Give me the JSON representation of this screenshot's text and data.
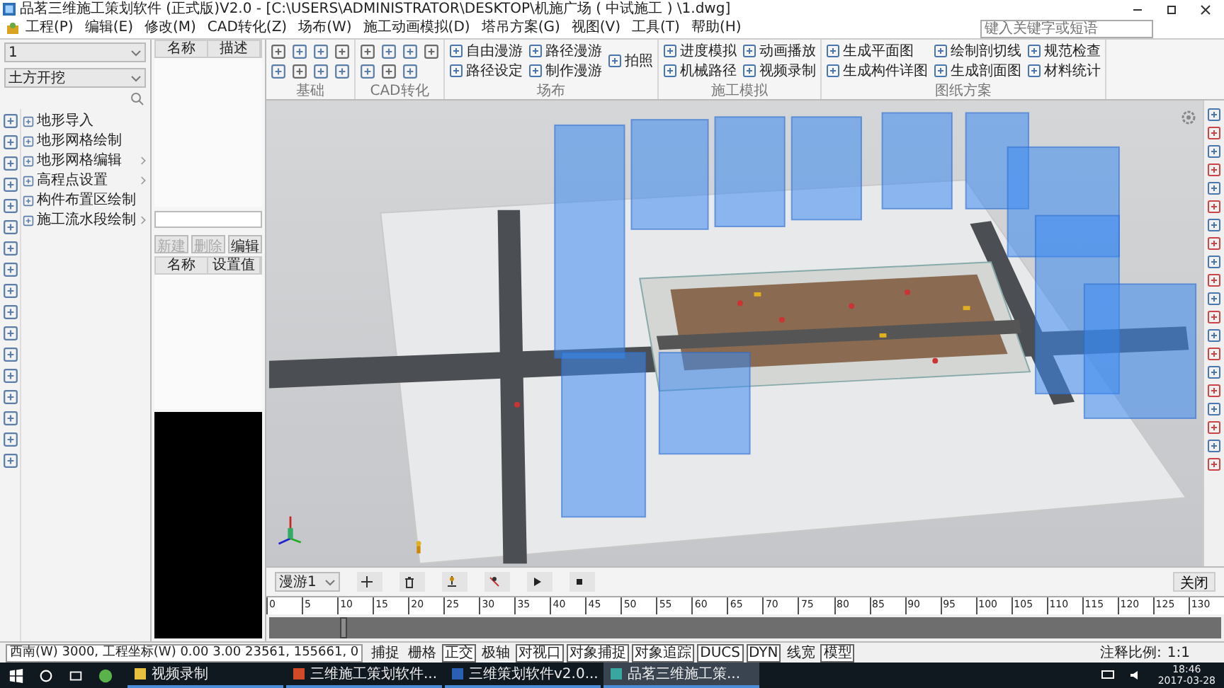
{
  "window": {
    "title": "品茗三维施工策划软件 (正式版)V2.0 - [C:\\USERS\\ADMINISTRATOR\\DESKTOP\\机施广场 ( 中试施工 ) \\1.dwg]"
  },
  "menu": [
    "工程(P)",
    "编辑(E)",
    "修改(M)",
    "CAD转化(Z)",
    "场布(W)",
    "施工动画模拟(D)",
    "塔吊方案(G)",
    "视图(V)",
    "工具(T)",
    "帮助(H)"
  ],
  "search": {
    "placeholder": "键入关键字或短语"
  },
  "ribbon": {
    "groups": [
      {
        "label": "基础",
        "kind": "icons"
      },
      {
        "label": "CAD转化",
        "kind": "icons"
      },
      {
        "label": "场布",
        "kind": "tools",
        "tools": [
          {
            "label": "自由漫游",
            "kind": "small"
          },
          {
            "label": "路径设定",
            "kind": "small"
          },
          {
            "label": "路径漫游",
            "kind": "small"
          },
          {
            "label": "制作漫游",
            "kind": "small"
          },
          {
            "label": "拍照",
            "kind": "large"
          }
        ]
      },
      {
        "label": "施工模拟",
        "kind": "tools",
        "tools": [
          {
            "label": "进度模拟",
            "kind": "small"
          },
          {
            "label": "机械路径",
            "kind": "small"
          },
          {
            "label": "动画播放",
            "kind": "small"
          },
          {
            "label": "视频录制",
            "kind": "small"
          }
        ]
      },
      {
        "label": "图纸方案",
        "kind": "tools",
        "tools": [
          {
            "label": "生成平面图",
            "kind": "small"
          },
          {
            "label": "生成构件详图",
            "kind": "small"
          },
          {
            "label": "绘制剖切线",
            "kind": "small"
          },
          {
            "label": "生成剖面图",
            "kind": "small"
          },
          {
            "label": "规范检查",
            "kind": "small"
          },
          {
            "label": "材料统计",
            "kind": "small"
          }
        ]
      }
    ]
  },
  "left_panel": {
    "layer": "1",
    "stage": "土方开挖",
    "items": [
      {
        "label": "地形导入",
        "has_submenu": false
      },
      {
        "label": "地形网格绘制",
        "has_submenu": false
      },
      {
        "label": "地形网格编辑",
        "has_submenu": true
      },
      {
        "label": "高程点设置",
        "has_submenu": true
      },
      {
        "label": "构件布置区绘制",
        "has_submenu": false
      },
      {
        "label": "施工流水段绘制",
        "has_submenu": true
      }
    ]
  },
  "props_panel": {
    "columns": [
      "名称",
      "描述"
    ],
    "buttons": [
      {
        "label": "新建",
        "disabled": true
      },
      {
        "label": "删除",
        "disabled": true
      },
      {
        "label": "编辑",
        "disabled": false
      }
    ],
    "settings_columns": [
      "名称",
      "设置值"
    ]
  },
  "animation": {
    "track": "漫游1",
    "close": "关闭",
    "ticks": [
      "0",
      "5",
      "10",
      "15",
      "20",
      "25",
      "30",
      "35",
      "40",
      "45",
      "50",
      "55",
      "60",
      "65",
      "70",
      "75",
      "80",
      "85",
      "90",
      "95",
      "100",
      "105",
      "110",
      "115",
      "120",
      "125",
      "130"
    ],
    "playhead": {
      "level": 0.075
    }
  },
  "status_bar": {
    "coords": "西南(W) 3000, 工程坐标(W) 0.00 3.00  23561,  155661,  0",
    "toggles": [
      {
        "label": "捕捉",
        "on": false
      },
      {
        "label": "栅格",
        "on": false
      },
      {
        "label": "正交",
        "on": true
      },
      {
        "label": "极轴",
        "on": false
      },
      {
        "label": "对视口",
        "on": true
      },
      {
        "label": "对象捕捉",
        "on": true
      },
      {
        "label": "对象追踪",
        "on": true
      },
      {
        "label": "DUCS",
        "on": true
      },
      {
        "label": "DYN",
        "on": true
      },
      {
        "label": "线宽",
        "on": false
      },
      {
        "label": "模型",
        "on": true
      }
    ],
    "scale_label": "注释比例:",
    "scale": "1:1"
  },
  "taskbar": {
    "items": [
      {
        "label": "视频录制",
        "kind": "folder",
        "selected": false
      },
      {
        "label": "三维施工策划软件...",
        "kind": "slides",
        "selected": false
      },
      {
        "label": "三维策划软件v2.0...",
        "kind": "document",
        "selected": false
      },
      {
        "label": "品茗三维施工策...",
        "kind": "app",
        "selected": true
      }
    ],
    "time": "18:46",
    "date": "2017-03-28"
  }
}
